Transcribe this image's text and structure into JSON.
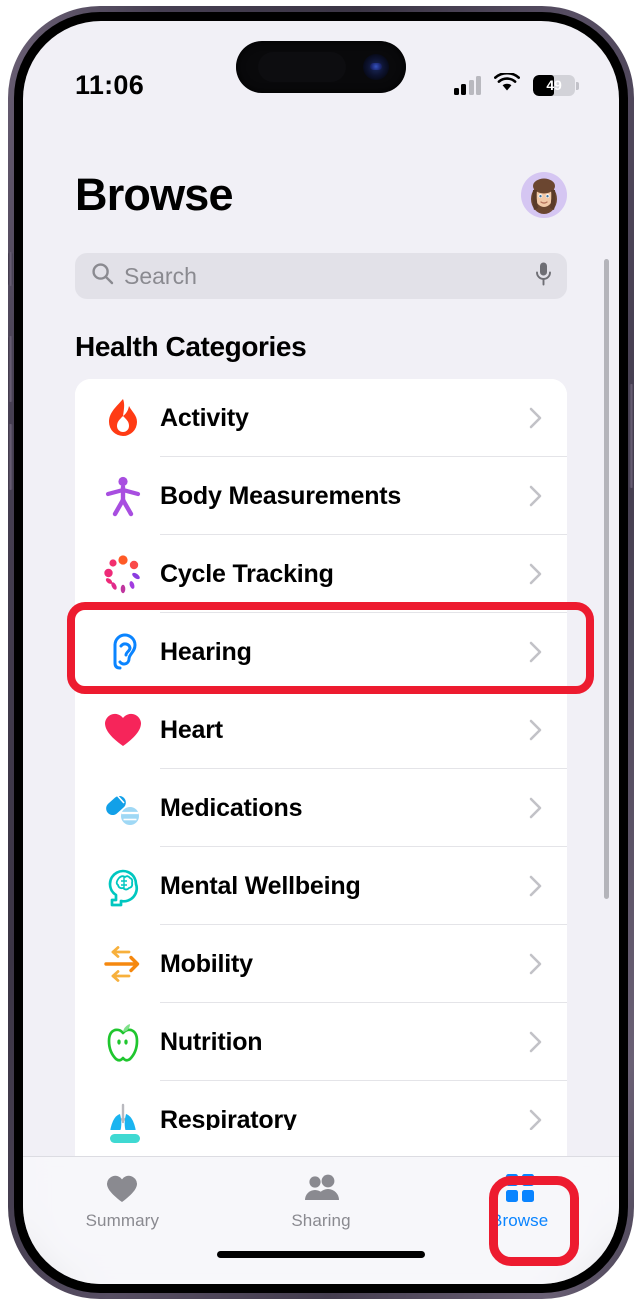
{
  "status_bar": {
    "time": "11:06",
    "signal_icon": "cellular-signal-icon",
    "wifi_icon": "wifi-icon",
    "battery_percent": "49",
    "battery_icon": "battery-icon"
  },
  "header": {
    "title": "Browse",
    "avatar_icon": "memoji-avatar",
    "avatar_bg": "#d5c6f2"
  },
  "search": {
    "placeholder": "Search",
    "search_icon": "search-icon",
    "mic_icon": "microphone-icon"
  },
  "main": {
    "section_title": "Health Categories",
    "chevron_icon": "chevron-right-icon",
    "categories": [
      {
        "label": "Activity",
        "icon": "flame-icon",
        "color": "#ff3b14"
      },
      {
        "label": "Body Measurements",
        "icon": "body-figure-icon",
        "color": "#a84ee0"
      },
      {
        "label": "Cycle Tracking",
        "icon": "cycle-dots-icon",
        "color": "#f0486b"
      },
      {
        "label": "Hearing",
        "icon": "ear-icon",
        "color": "#0a84ff"
      },
      {
        "label": "Heart",
        "icon": "heart-icon",
        "color": "#f6255a"
      },
      {
        "label": "Medications",
        "icon": "pills-icon",
        "color": "#12a0e8"
      },
      {
        "label": "Mental Wellbeing",
        "icon": "head-brain-icon",
        "color": "#00c7c0"
      },
      {
        "label": "Mobility",
        "icon": "arrows-horizontal-icon",
        "color": "#f5981f"
      },
      {
        "label": "Nutrition",
        "icon": "apple-icon",
        "color": "#1fc62e"
      },
      {
        "label": "Respiratory",
        "icon": "lungs-icon",
        "color": "#1ab4f0"
      }
    ]
  },
  "tab_bar": {
    "tabs": [
      {
        "label": "Summary",
        "icon": "heart-filled-icon",
        "active": false
      },
      {
        "label": "Sharing",
        "icon": "two-people-icon",
        "active": false
      },
      {
        "label": "Browse",
        "icon": "grid-squares-icon",
        "active": true
      }
    ],
    "active_color": "#0a84ff",
    "inactive_color": "#8a8a90"
  },
  "annotations": {
    "highlight_color": "#ED1B2F",
    "hearing_target": "Hearing",
    "browse_target": "Browse"
  }
}
